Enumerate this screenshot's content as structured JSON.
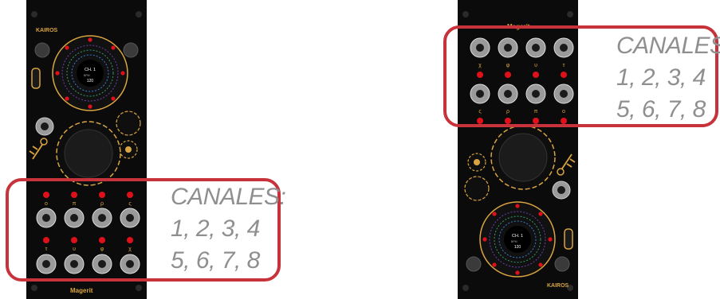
{
  "panel_a": {
    "brand": "KAIROS",
    "display": {
      "channel": "CH. 1",
      "bpm_label": "BPM",
      "bpm_value": "120"
    },
    "jack_labels_top": [
      "o",
      "π",
      "ρ",
      "ς"
    ],
    "jack_labels_bottom": [
      "τ",
      "υ",
      "φ",
      "χ"
    ],
    "footer_logo": "Magerit"
  },
  "panel_b": {
    "brand": "KAIROS",
    "display": {
      "channel": "CH. 1",
      "bpm_label": "BPM",
      "bpm_value": "120"
    },
    "jack_labels_top": [
      "χ",
      "φ",
      "υ",
      "τ"
    ],
    "jack_labels_bottom": [
      "ς",
      "ρ",
      "π",
      "o"
    ],
    "header_logo": "Magerit"
  },
  "callout_a": {
    "title": "CANALES:",
    "line1": "1, 2, 3, 4",
    "line2": "5, 6, 7, 8"
  },
  "callout_b": {
    "title": "CANALES:",
    "line1": "1, 2, 3, 4",
    "line2": "5, 6, 7, 8"
  },
  "colors": {
    "panel": "#0b0b0b",
    "accent_gold": "#d9a441",
    "led_red": "#e0101a",
    "callout_red": "#c8323a",
    "callout_text": "#8f8f8f"
  }
}
